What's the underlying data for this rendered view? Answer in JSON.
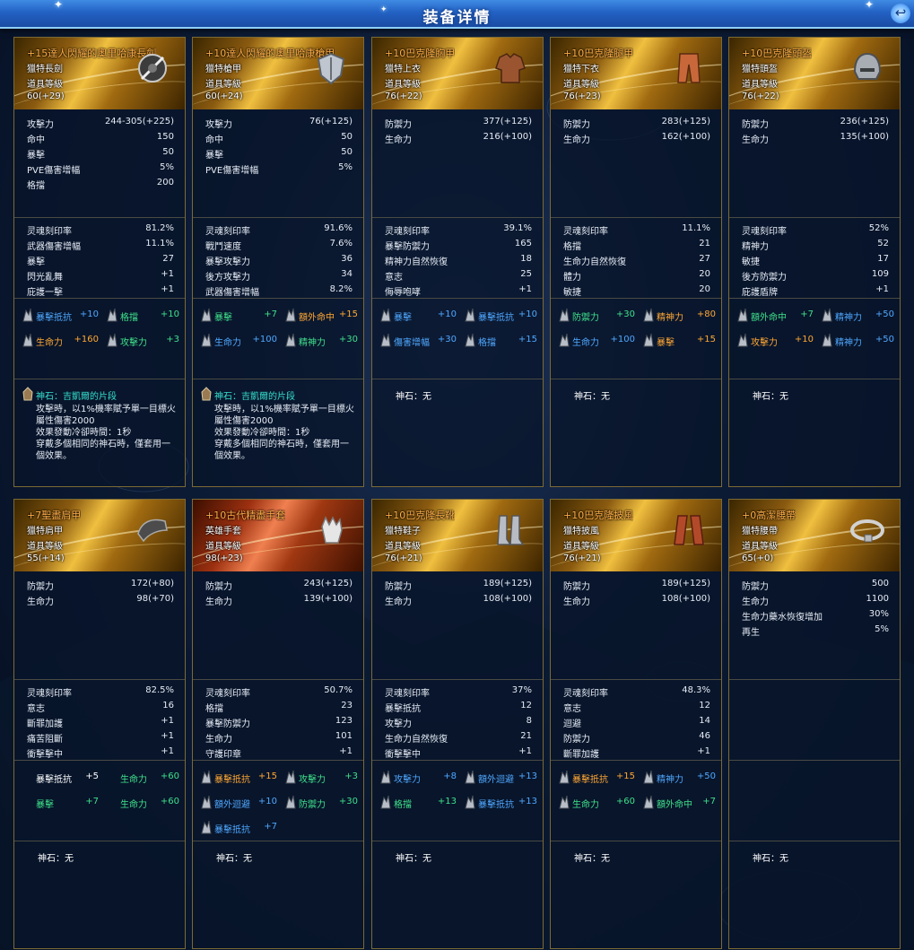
{
  "window": {
    "title": "装备详情",
    "close_label": "↩"
  },
  "rows": [
    {
      "cards": [
        {
          "header": {
            "name": "+15達人閃耀的奧里哈康長劍",
            "type": "獵特長劍",
            "level_label": "道具等級",
            "level": "60(+29)",
            "name_color": "#ffae48",
            "theme": "gold",
            "icon": "sword-icon"
          },
          "base": [
            {
              "k": "攻擊力",
              "v": "244-305(+225)"
            },
            {
              "k": "命中",
              "v": "150"
            },
            {
              "k": "暴擊",
              "v": "50"
            },
            {
              "k": "PVE傷害增幅",
              "v": "5%"
            },
            {
              "k": "格擋",
              "v": "200"
            }
          ],
          "bonus": [
            {
              "k": "灵魂刻印率",
              "v": "81.2%"
            },
            {
              "k": "武器傷害增幅",
              "v": "11.1%"
            },
            {
              "k": "暴擊",
              "v": "27"
            },
            {
              "k": "閃光亂舞",
              "v": "+1"
            },
            {
              "k": "庇護一擊",
              "v": "+1"
            }
          ],
          "manastones": [
            {
              "n": "暴擊抵抗",
              "v": "+10",
              "c": "blue",
              "vc": "blue",
              "icon": true
            },
            {
              "n": "格擋",
              "v": "+10",
              "c": "green",
              "vc": "green",
              "icon": true
            },
            {
              "n": "生命力",
              "v": "+160",
              "c": "orange",
              "vc": "orange",
              "icon": true
            },
            {
              "n": "攻擊力",
              "v": "+3",
              "c": "green",
              "vc": "green",
              "icon": true
            }
          ],
          "godstone": {
            "title": "神石：吉凱爾的片段",
            "desc": "攻擊時，以1%機率賦予單一目標火\n屬性傷害2000\n效果發動冷卻時間：1秒\n穿戴多個相同的神石時，僅套用一\n個效果。",
            "none": ""
          }
        },
        {
          "header": {
            "name": "+10達人閃耀的奧里哈康槍甲",
            "type": "獵特槍甲",
            "level_label": "道具等級",
            "level": "60(+24)",
            "name_color": "#ffae48",
            "theme": "gold",
            "icon": "shield-icon"
          },
          "base": [
            {
              "k": "攻擊力",
              "v": "76(+125)"
            },
            {
              "k": "命中",
              "v": "50"
            },
            {
              "k": "暴擊",
              "v": "50"
            },
            {
              "k": "PVE傷害增幅",
              "v": "5%"
            }
          ],
          "bonus": [
            {
              "k": "灵魂刻印率",
              "v": "91.6%"
            },
            {
              "k": "戰鬥速度",
              "v": "7.6%"
            },
            {
              "k": "暴擊攻擊力",
              "v": "36"
            },
            {
              "k": "後方攻擊力",
              "v": "34"
            },
            {
              "k": "武器傷害增幅",
              "v": "8.2%"
            }
          ],
          "manastones": [
            {
              "n": "暴擊",
              "v": "+7",
              "c": "green",
              "vc": "green",
              "icon": true
            },
            {
              "n": "額外命中",
              "v": "+15",
              "c": "orange",
              "vc": "orange",
              "icon": true
            },
            {
              "n": "生命力",
              "v": "+100",
              "c": "blue",
              "vc": "blue",
              "icon": true
            },
            {
              "n": "精神力",
              "v": "+30",
              "c": "green",
              "vc": "green",
              "icon": true
            }
          ],
          "godstone": {
            "title": "神石：吉凱爾的片段",
            "desc": "攻擊時，以1%機率賦予單一目標火\n屬性傷害2000\n效果發動冷卻時間：1秒\n穿戴多個相同的神石時，僅套用一\n個效果。",
            "none": ""
          }
        },
        {
          "header": {
            "name": "+10巴克隆胸甲",
            "type": "獵特上衣",
            "level_label": "道具等級",
            "level": "76(+22)",
            "name_color": "#ffae48",
            "theme": "gold",
            "icon": "chest-armor-icon"
          },
          "base": [
            {
              "k": "防禦力",
              "v": "377(+125)"
            },
            {
              "k": "生命力",
              "v": "216(+100)"
            }
          ],
          "bonus": [
            {
              "k": "灵魂刻印率",
              "v": "39.1%"
            },
            {
              "k": "暴擊防禦力",
              "v": "165"
            },
            {
              "k": "精神力自然恢復",
              "v": "18"
            },
            {
              "k": "意志",
              "v": "25"
            },
            {
              "k": "侮辱咆哮",
              "v": "+1"
            }
          ],
          "manastones": [
            {
              "n": "暴擊",
              "v": "+10",
              "c": "blue",
              "vc": "blue",
              "icon": true
            },
            {
              "n": "暴擊抵抗",
              "v": "+10",
              "c": "blue",
              "vc": "blue",
              "icon": true
            },
            {
              "n": "傷害增幅",
              "v": "+30",
              "c": "blue",
              "vc": "blue",
              "icon": true
            },
            {
              "n": "格擋",
              "v": "+15",
              "c": "blue",
              "vc": "blue",
              "icon": true
            }
          ],
          "godstone": {
            "title": "",
            "desc": "",
            "none": "神石：无"
          }
        },
        {
          "header": {
            "name": "+10巴克隆腿甲",
            "type": "獵特下衣",
            "level_label": "道具等級",
            "level": "76(+23)",
            "name_color": "#ffae48",
            "theme": "gold",
            "icon": "leg-armor-icon"
          },
          "base": [
            {
              "k": "防禦力",
              "v": "283(+125)"
            },
            {
              "k": "生命力",
              "v": "162(+100)"
            }
          ],
          "bonus": [
            {
              "k": "灵魂刻印率",
              "v": "11.1%"
            },
            {
              "k": "格擋",
              "v": "21"
            },
            {
              "k": "生命力自然恢復",
              "v": "27"
            },
            {
              "k": "體力",
              "v": "20"
            },
            {
              "k": "敏捷",
              "v": "20"
            }
          ],
          "manastones": [
            {
              "n": "防禦力",
              "v": "+30",
              "c": "green",
              "vc": "green",
              "icon": true
            },
            {
              "n": "精神力",
              "v": "+80",
              "c": "orange",
              "vc": "orange",
              "icon": true
            },
            {
              "n": "生命力",
              "v": "+100",
              "c": "blue",
              "vc": "blue",
              "icon": true
            },
            {
              "n": "暴擊",
              "v": "+15",
              "c": "orange",
              "vc": "orange",
              "icon": true
            }
          ],
          "godstone": {
            "title": "",
            "desc": "",
            "none": "神石：无"
          }
        },
        {
          "header": {
            "name": "+10巴克隆頭盔",
            "type": "獵特頭盔",
            "level_label": "道具等級",
            "level": "76(+22)",
            "name_color": "#ffae48",
            "theme": "gold",
            "icon": "helmet-icon"
          },
          "base": [
            {
              "k": "防禦力",
              "v": "236(+125)"
            },
            {
              "k": "生命力",
              "v": "135(+100)"
            }
          ],
          "bonus": [
            {
              "k": "灵魂刻印率",
              "v": "52%"
            },
            {
              "k": "精神力",
              "v": "52"
            },
            {
              "k": "敏捷",
              "v": "17"
            },
            {
              "k": "後方防禦力",
              "v": "109"
            },
            {
              "k": "庇護盾牌",
              "v": "+1"
            }
          ],
          "manastones": [
            {
              "n": "額外命中",
              "v": "+7",
              "c": "green",
              "vc": "green",
              "icon": true
            },
            {
              "n": "精神力",
              "v": "+50",
              "c": "blue",
              "vc": "blue",
              "icon": true
            },
            {
              "n": "攻擊力",
              "v": "+10",
              "c": "orange",
              "vc": "orange",
              "icon": true
            },
            {
              "n": "精神力",
              "v": "+50",
              "c": "blue",
              "vc": "blue",
              "icon": true
            }
          ],
          "godstone": {
            "title": "",
            "desc": "",
            "none": "神石：无"
          }
        }
      ]
    },
    {
      "cards": [
        {
          "header": {
            "name": "+7聖盡肩甲",
            "type": "獵特肩甲",
            "level_label": "道具等級",
            "level": "55(+14)",
            "name_color": "#ffae48",
            "theme": "gold",
            "icon": "shoulder-armor-icon"
          },
          "base": [
            {
              "k": "防禦力",
              "v": "172(+80)"
            },
            {
              "k": "生命力",
              "v": "98(+70)"
            }
          ],
          "bonus": [
            {
              "k": "灵魂刻印率",
              "v": "82.5%"
            },
            {
              "k": "意志",
              "v": "16"
            },
            {
              "k": "斷罪加護",
              "v": "+1"
            },
            {
              "k": "痛苦阻斷",
              "v": "+1"
            },
            {
              "k": "衝擊擊中",
              "v": "+1"
            }
          ],
          "manastones": [
            {
              "n": "暴擊抵抗",
              "v": "+5",
              "c": "white",
              "vc": "white",
              "icon": false
            },
            {
              "n": "生命力",
              "v": "+60",
              "c": "green",
              "vc": "green",
              "icon": false
            },
            {
              "n": "暴擊",
              "v": "+7",
              "c": "green",
              "vc": "green",
              "icon": false
            },
            {
              "n": "生命力",
              "v": "+60",
              "c": "green",
              "vc": "green",
              "icon": false
            }
          ],
          "godstone": {
            "title": "",
            "desc": "",
            "none": "神石：无"
          }
        },
        {
          "header": {
            "name": "+10古代精盡手套",
            "type": "英雄手套",
            "level_label": "道具等級",
            "level": "98(+23)",
            "name_color": "#ffae48",
            "theme": "red",
            "icon": "glove-icon"
          },
          "base": [
            {
              "k": "防禦力",
              "v": "243(+125)"
            },
            {
              "k": "生命力",
              "v": "139(+100)"
            }
          ],
          "bonus": [
            {
              "k": "灵魂刻印率",
              "v": "50.7%"
            },
            {
              "k": "格擋",
              "v": "23"
            },
            {
              "k": "暴擊防禦力",
              "v": "123"
            },
            {
              "k": "生命力",
              "v": "101"
            },
            {
              "k": "守護印章",
              "v": "+1"
            }
          ],
          "manastones": [
            {
              "n": "暴擊抵抗",
              "v": "+15",
              "c": "orange",
              "vc": "orange",
              "icon": true
            },
            {
              "n": "攻擊力",
              "v": "+3",
              "c": "green",
              "vc": "green",
              "icon": true
            },
            {
              "n": "額外迴避",
              "v": "+10",
              "c": "blue",
              "vc": "blue",
              "icon": true
            },
            {
              "n": "防禦力",
              "v": "+30",
              "c": "green",
              "vc": "green",
              "icon": true
            },
            {
              "n": "暴擊抵抗",
              "v": "+7",
              "c": "blue",
              "vc": "blue",
              "icon": true
            }
          ],
          "godstone": {
            "title": "",
            "desc": "",
            "none": "神石：无"
          }
        },
        {
          "header": {
            "name": "+10巴克隆長靴",
            "type": "獵特鞋子",
            "level_label": "道具等級",
            "level": "76(+21)",
            "name_color": "#ffae48",
            "theme": "gold",
            "icon": "boots-icon"
          },
          "base": [
            {
              "k": "防禦力",
              "v": "189(+125)"
            },
            {
              "k": "生命力",
              "v": "108(+100)"
            }
          ],
          "bonus": [
            {
              "k": "灵魂刻印率",
              "v": "37%"
            },
            {
              "k": "暴擊抵抗",
              "v": "12"
            },
            {
              "k": "攻擊力",
              "v": "8"
            },
            {
              "k": "生命力自然恢復",
              "v": "21"
            },
            {
              "k": "衝擊擊中",
              "v": "+1"
            }
          ],
          "manastones": [
            {
              "n": "攻擊力",
              "v": "+8",
              "c": "blue",
              "vc": "blue",
              "icon": true
            },
            {
              "n": "額外迴避",
              "v": "+13",
              "c": "blue",
              "vc": "blue",
              "icon": true
            },
            {
              "n": "格擋",
              "v": "+13",
              "c": "green",
              "vc": "green",
              "icon": true
            },
            {
              "n": "暴擊抵抗",
              "v": "+13",
              "c": "blue",
              "vc": "blue",
              "icon": true
            }
          ],
          "godstone": {
            "title": "",
            "desc": "",
            "none": "神石：无"
          }
        },
        {
          "header": {
            "name": "+10巴克隆披風",
            "type": "獵特披風",
            "level_label": "道具等級",
            "level": "76(+21)",
            "name_color": "#ffae48",
            "theme": "gold",
            "icon": "cape-icon"
          },
          "base": [
            {
              "k": "防禦力",
              "v": "189(+125)"
            },
            {
              "k": "生命力",
              "v": "108(+100)"
            }
          ],
          "bonus": [
            {
              "k": "灵魂刻印率",
              "v": "48.3%"
            },
            {
              "k": "意志",
              "v": "12"
            },
            {
              "k": "迴避",
              "v": "14"
            },
            {
              "k": "防禦力",
              "v": "46"
            },
            {
              "k": "斷罪加護",
              "v": "+1"
            }
          ],
          "manastones": [
            {
              "n": "暴擊抵抗",
              "v": "+15",
              "c": "orange",
              "vc": "orange",
              "icon": true
            },
            {
              "n": "精神力",
              "v": "+50",
              "c": "blue",
              "vc": "blue",
              "icon": true
            },
            {
              "n": "生命力",
              "v": "+60",
              "c": "green",
              "vc": "green",
              "icon": true
            },
            {
              "n": "額外命中",
              "v": "+7",
              "c": "green",
              "vc": "green",
              "icon": true
            }
          ],
          "godstone": {
            "title": "",
            "desc": "",
            "none": "神石：无"
          }
        },
        {
          "header": {
            "name": "+0高潔腰帶",
            "type": "獵特腰帶",
            "level_label": "道具等級",
            "level": "65(+0)",
            "name_color": "#ffae48",
            "theme": "gold",
            "icon": "belt-icon"
          },
          "base": [
            {
              "k": "防禦力",
              "v": "500"
            },
            {
              "k": "生命力",
              "v": "1100"
            },
            {
              "k": "生命力藥水恢復增加",
              "v": "30%"
            },
            {
              "k": "再生",
              "v": "5%"
            }
          ],
          "bonus": [],
          "manastones": [],
          "godstone": {
            "title": "",
            "desc": "",
            "none": "神石：无"
          }
        }
      ]
    }
  ],
  "colors": {
    "blue": "#4fa8ff",
    "green": "#3fe08a",
    "orange": "#ffa733",
    "white": "#ffffff",
    "teal": "#36e0cf",
    "gold_border": "#7c6a34",
    "title_bar": "#2362c4"
  }
}
